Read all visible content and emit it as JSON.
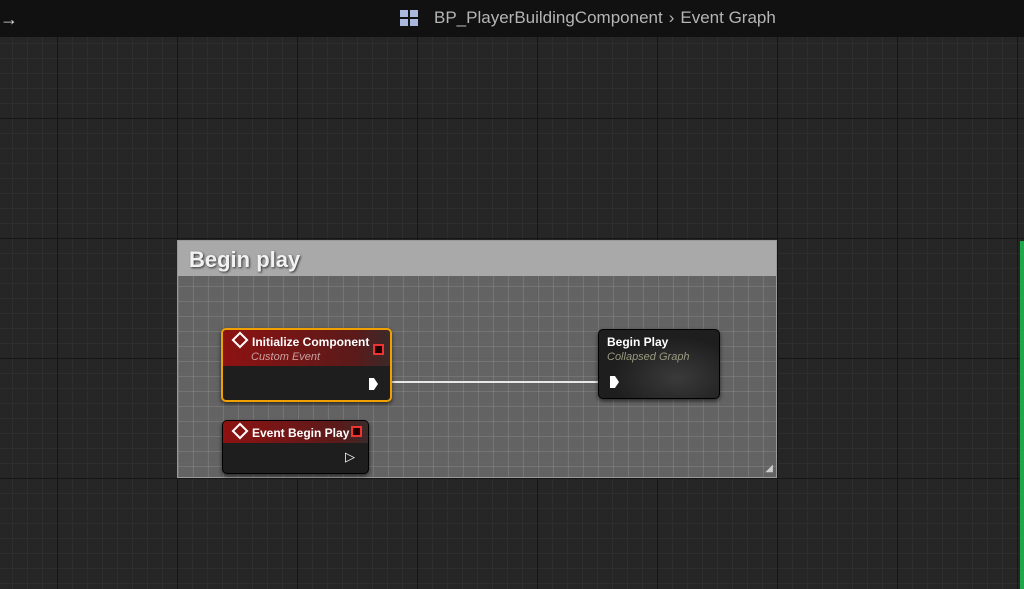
{
  "header": {
    "blueprint": "BP_PlayerBuildingComponent",
    "separator": "›",
    "graph": "Event Graph",
    "back_icon": "→"
  },
  "comment": {
    "title": "Begin play"
  },
  "nodes": [
    {
      "title": "Initialize Component",
      "subtitle": "Custom Event"
    },
    {
      "title": "Event Begin Play"
    },
    {
      "title": "Begin Play",
      "subtitle": "Collapsed Graph"
    }
  ],
  "colors": {
    "event_header": "#8e1212",
    "selection": "#f0a000",
    "wire": "#e8e8e8"
  }
}
